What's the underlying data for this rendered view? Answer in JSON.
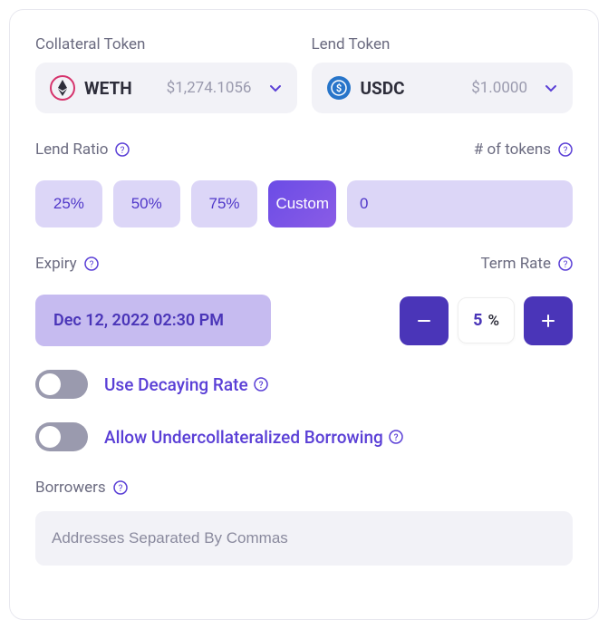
{
  "collateral": {
    "label": "Collateral Token",
    "symbol": "WETH",
    "price": "$1,274.1056"
  },
  "lend": {
    "label": "Lend Token",
    "symbol": "USDC",
    "price": "$1.0000"
  },
  "lendRatio": {
    "label": "Lend Ratio",
    "options": {
      "o0": "25%",
      "o1": "50%",
      "o2": "75%",
      "o3": "Custom"
    },
    "tokensLabel": "# of tokens",
    "tokensValue": "0"
  },
  "expiry": {
    "label": "Expiry",
    "value": "Dec 12, 2022 02:30 PM"
  },
  "termRate": {
    "label": "Term Rate",
    "value": "5",
    "unit": "%"
  },
  "toggles": {
    "decaying": "Use Decaying Rate",
    "undercollat": "Allow Undercollateralized Borrowing"
  },
  "borrowers": {
    "label": "Borrowers",
    "placeholder": "Addresses Separated By Commas"
  }
}
